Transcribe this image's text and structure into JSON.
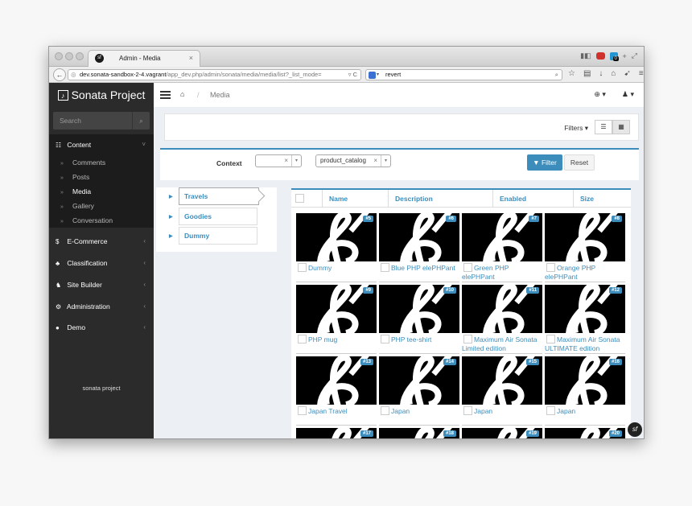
{
  "browser": {
    "tab_title": "Admin - Media",
    "tab_close": "×",
    "url_host": "dev.sonata-sandbox-2-4.vagrant",
    "url_path": "/app_dev.php/admin/sonata/media/media/list?_list_mode=",
    "search_text": "revert",
    "ext_badge": "0"
  },
  "header": {
    "brand": "Sonata Project",
    "breadcrumb_current": "Media",
    "breadcrumb_sep": "/"
  },
  "sidebar": {
    "search_placeholder": "Search",
    "sections": [
      {
        "label": "Content",
        "icon": "☷"
      },
      {
        "label": "E-Commerce",
        "icon": "$"
      },
      {
        "label": "Classification",
        "icon": "♣"
      },
      {
        "label": "Site Builder",
        "icon": "♞"
      },
      {
        "label": "Administration",
        "icon": "⚙"
      },
      {
        "label": "Demo",
        "icon": "●"
      }
    ],
    "content_items": [
      "Comments",
      "Posts",
      "Media",
      "Gallery",
      "Conversation"
    ],
    "footer": "sonata project"
  },
  "filters": {
    "filters_label": "Filters",
    "context_label": "Context",
    "context_value": "product_catalog",
    "filter_button": "Filter",
    "reset_button": "Reset"
  },
  "tree": [
    "Travels",
    "Goodies",
    "Dummy"
  ],
  "grid": {
    "columns": [
      "Name",
      "Description",
      "Enabled",
      "Size"
    ],
    "items": [
      {
        "id": "#5",
        "name": "Dummy"
      },
      {
        "id": "#6",
        "name": "Blue PHP elePHPant"
      },
      {
        "id": "#7",
        "name": "Green PHP elePHPant"
      },
      {
        "id": "#8",
        "name": "Orange PHP elePHPant"
      },
      {
        "id": "#9",
        "name": "PHP mug"
      },
      {
        "id": "#10",
        "name": "PHP tee-shirt"
      },
      {
        "id": "#11",
        "name": "Maximum Air Sonata Limited edition"
      },
      {
        "id": "#12",
        "name": "Maximum Air Sonata ULTIMATE edition"
      },
      {
        "id": "#13",
        "name": "Japan Travel"
      },
      {
        "id": "#14",
        "name": "Japan"
      },
      {
        "id": "#15",
        "name": "Japan"
      },
      {
        "id": "#16",
        "name": "Japan"
      },
      {
        "id": "#17",
        "name": ""
      },
      {
        "id": "#18",
        "name": ""
      },
      {
        "id": "#19",
        "name": ""
      },
      {
        "id": "#20",
        "name": ""
      }
    ]
  },
  "colors": {
    "accent": "#3c8dbc",
    "sidebar": "#2b2b2b"
  }
}
